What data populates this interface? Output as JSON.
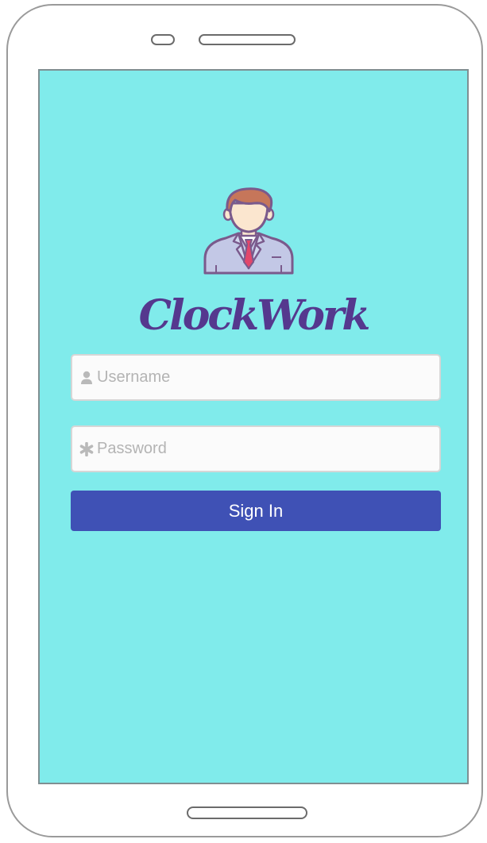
{
  "app": {
    "title": "ClockWork"
  },
  "login": {
    "username_placeholder": "Username",
    "username_value": "",
    "password_placeholder": "Password",
    "password_value": "",
    "submit_label": "Sign In"
  },
  "icons": {
    "avatar": "businessman-avatar-icon",
    "username": "user-icon",
    "password": "asterisk-icon"
  },
  "colors": {
    "screen_background": "#80ebeb",
    "brand_text": "#55388e",
    "button": "#3f51b5",
    "button_text": "#ffffff",
    "input_background": "#fbfbfb",
    "placeholder": "#b4b4b4"
  }
}
